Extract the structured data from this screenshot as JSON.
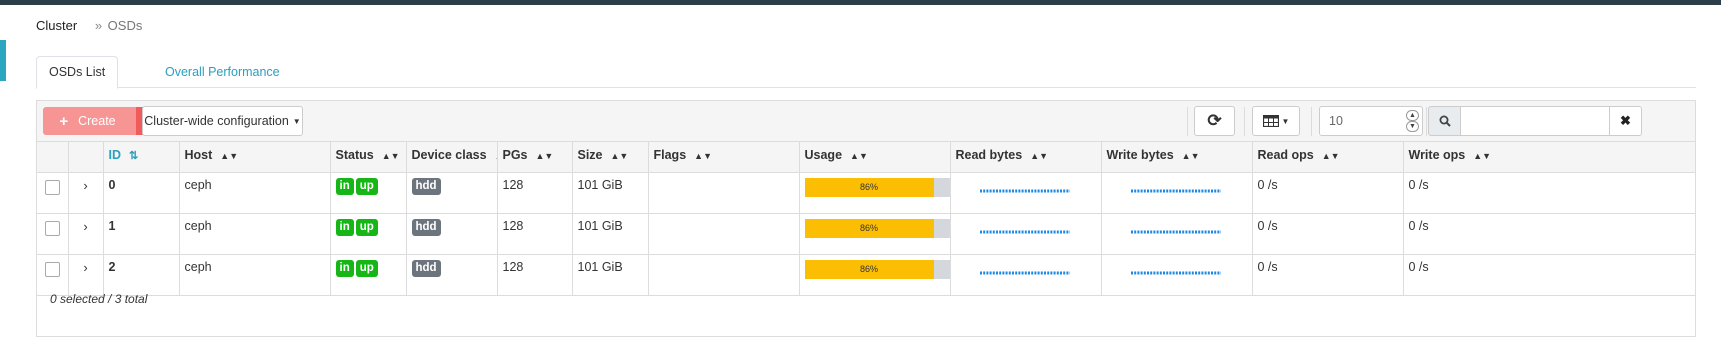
{
  "breadcrumb": {
    "root": "Cluster",
    "separator": "»",
    "current": "OSDs"
  },
  "tabs": [
    {
      "label": "OSDs List",
      "active": true
    },
    {
      "label": "Overall Performance",
      "active": false
    }
  ],
  "toolbar": {
    "create_label": "Create",
    "config_label": "Cluster-wide configuration",
    "page_size": "10",
    "search_placeholder": ""
  },
  "table": {
    "columns": [
      {
        "label": "ID",
        "sorted": true
      },
      {
        "label": "Host"
      },
      {
        "label": "Status"
      },
      {
        "label": "Device class"
      },
      {
        "label": "PGs"
      },
      {
        "label": "Size"
      },
      {
        "label": "Flags"
      },
      {
        "label": "Usage"
      },
      {
        "label": "Read bytes"
      },
      {
        "label": "Write bytes"
      },
      {
        "label": "Read ops"
      },
      {
        "label": "Write ops"
      }
    ],
    "rows": [
      {
        "id": "0",
        "host": "ceph",
        "status": [
          "in",
          "up"
        ],
        "device_class": "hdd",
        "pgs": "128",
        "size": "101 GiB",
        "flags": "",
        "usage_label": "86%",
        "usage_value": 0.86,
        "read_ops": "0 /s",
        "write_ops": "0 /s"
      },
      {
        "id": "1",
        "host": "ceph",
        "status": [
          "in",
          "up"
        ],
        "device_class": "hdd",
        "pgs": "128",
        "size": "101 GiB",
        "flags": "",
        "usage_label": "86%",
        "usage_value": 0.86,
        "read_ops": "0 /s",
        "write_ops": "0 /s"
      },
      {
        "id": "2",
        "host": "ceph",
        "status": [
          "in",
          "up"
        ],
        "device_class": "hdd",
        "pgs": "128",
        "size": "101 GiB",
        "flags": "",
        "usage_label": "86%",
        "usage_value": 0.86,
        "read_ops": "0 /s",
        "write_ops": "0 /s"
      }
    ]
  },
  "footer": {
    "selection_summary": "0 selected / 3 total"
  },
  "colors": {
    "accent": "#2a9fc0",
    "create": "#f69594",
    "badge_status": "#17b617",
    "badge_class": "#6c757d",
    "usage_fill": "#fcbe03",
    "sparkline": "#1e88e5"
  }
}
